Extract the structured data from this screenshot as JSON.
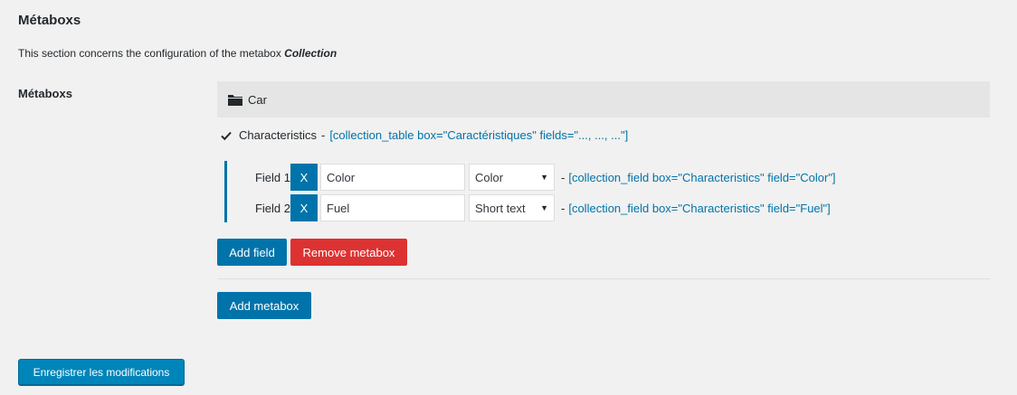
{
  "section": {
    "title": "Métaboxs",
    "description_prefix": "This section concerns the configuration of the metabox ",
    "description_emphasis": "Collection"
  },
  "row_label": "Métaboxs",
  "metabox": {
    "icon": "folder-icon",
    "name": "Car",
    "group": {
      "check_icon": "check-icon",
      "label": "Characteristics",
      "separator": "-",
      "shortcode": "[collection_table box=\"Caractéristiques\" fields=\"..., ..., ...\"]"
    },
    "fields": [
      {
        "label": "Field 1",
        "remove_label": "X",
        "value": "Color",
        "type": "Color",
        "shortcode": "[collection_field box=\"Characteristics\" field=\"Color\"]"
      },
      {
        "label": "Field 2",
        "remove_label": "X",
        "value": "Fuel",
        "type": "Short text",
        "shortcode": "[collection_field box=\"Characteristics\" field=\"Fuel\"]"
      }
    ],
    "add_field_label": "Add field",
    "remove_metabox_label": "Remove metabox"
  },
  "add_metabox_label": "Add metabox",
  "save_label": "Enregistrer les modifications",
  "colors": {
    "primary": "#0073aa",
    "danger": "#dc3232",
    "save": "#0085ba",
    "background": "#f1f1f1"
  }
}
